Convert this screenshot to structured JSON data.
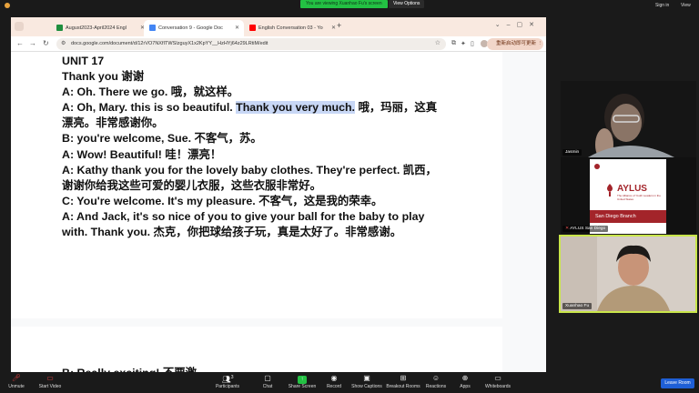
{
  "zoom_top": {
    "viewing_banner": "You are viewing Xuanhao Fu's screen",
    "view_options": "View Options",
    "sign_in": "Sign in",
    "view": "View"
  },
  "browser": {
    "tabs": [
      {
        "label": "August2023-April2024 Engl",
        "favicon_color": "#1e8e3e"
      },
      {
        "label": "Conversation 9 - Google Doc",
        "favicon_color": "#4285f4"
      },
      {
        "label": "English Conversation 03 - Yo",
        "favicon_color": "#ff0000"
      }
    ],
    "url": "docs.google.com/document/d/12rVO7NXfITWSIzguyX1x2KpYY__HzHYj64z29LRtiM/edit",
    "restart_button": "重新启动即可更新"
  },
  "document": {
    "lines": [
      "UNIT 17",
      "Thank you 谢谢",
      "A: Oh. There we go. 哦，就这样。",
      "A: Oh, Mary. this is so beautiful. ",
      "漂亮。非常感谢你。",
      "B: you're welcome, Sue. 不客气，苏。",
      "A: Wow! Beautiful! 哇！漂亮！",
      "A: Kathy thank you for the lovely baby clothes. They're perfect. 凯西，",
      "谢谢你给我这些可爱的婴儿衣服，这些衣服非常好。",
      "C: You're welcome. It's my pleasure. 不客气，这是我的荣幸。",
      "A: And Jack, it's so nice of you to give your ball for the baby to play",
      "with. Thank you. 杰克，你把球给孩子玩，真是太好了。非常感谢。"
    ],
    "highlighted": "Thank you very much.",
    "after_highlight": " 哦，玛丽，这真",
    "page2_partial": "B: Really exciting! 不要激"
  },
  "participants": {
    "jasmin": "Jasmin",
    "aylus": "AYLUS San Diego",
    "xuanhao": "Xuanhao Fu",
    "aylus_logo_text": "AYLUS",
    "aylus_subtitle": "The Alliance of Youth Leaders in the United States",
    "aylus_branch": "San Diego Branch",
    "aylus_red": "#a3242a"
  },
  "zoom_bar": {
    "items": [
      {
        "label": "Unmute",
        "icon": "mic-icon"
      },
      {
        "label": "Start Video",
        "icon": "video-icon"
      },
      {
        "label": "Participants",
        "count": "3",
        "icon": "participants-icon"
      },
      {
        "label": "Chat",
        "icon": "chat-icon"
      },
      {
        "label": "Share Screen",
        "icon": "share-icon"
      },
      {
        "label": "Record",
        "icon": "record-icon"
      },
      {
        "label": "Show Captions",
        "icon": "cc-icon"
      },
      {
        "label": "Breakout Rooms",
        "icon": "breakout-icon"
      },
      {
        "label": "Reactions",
        "icon": "reactions-icon"
      },
      {
        "label": "Apps",
        "icon": "apps-icon"
      },
      {
        "label": "Whiteboards",
        "icon": "whiteboard-icon"
      }
    ],
    "leave": "Leave Room"
  }
}
